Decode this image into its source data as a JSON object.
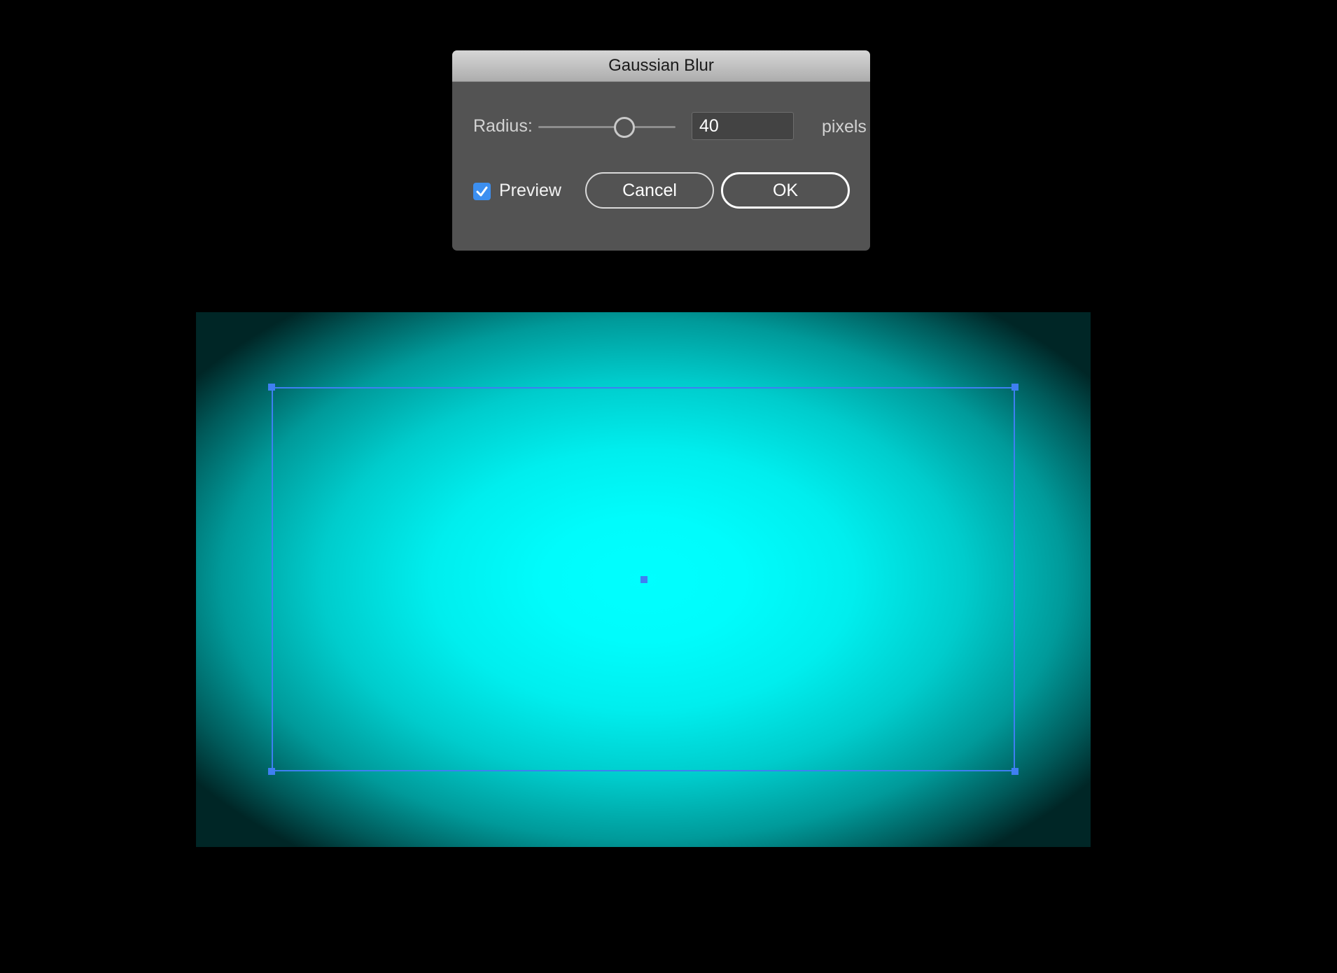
{
  "dialog": {
    "title": "Gaussian Blur",
    "radius_label": "Radius:",
    "radius_value": "40",
    "radius_unit": "pixels",
    "slider_level_percent": 62,
    "preview_label": "Preview",
    "preview_checked": true,
    "cancel_label": "Cancel",
    "ok_label": "OK"
  },
  "icons": {
    "checkbox": "checkmark-icon",
    "slider": "slider-thumb-icon"
  },
  "colors": {
    "glow": "#00ffff",
    "selection": "#3f7ff2",
    "dialog_bg": "#535353",
    "checkbox": "#3c8ff0"
  }
}
